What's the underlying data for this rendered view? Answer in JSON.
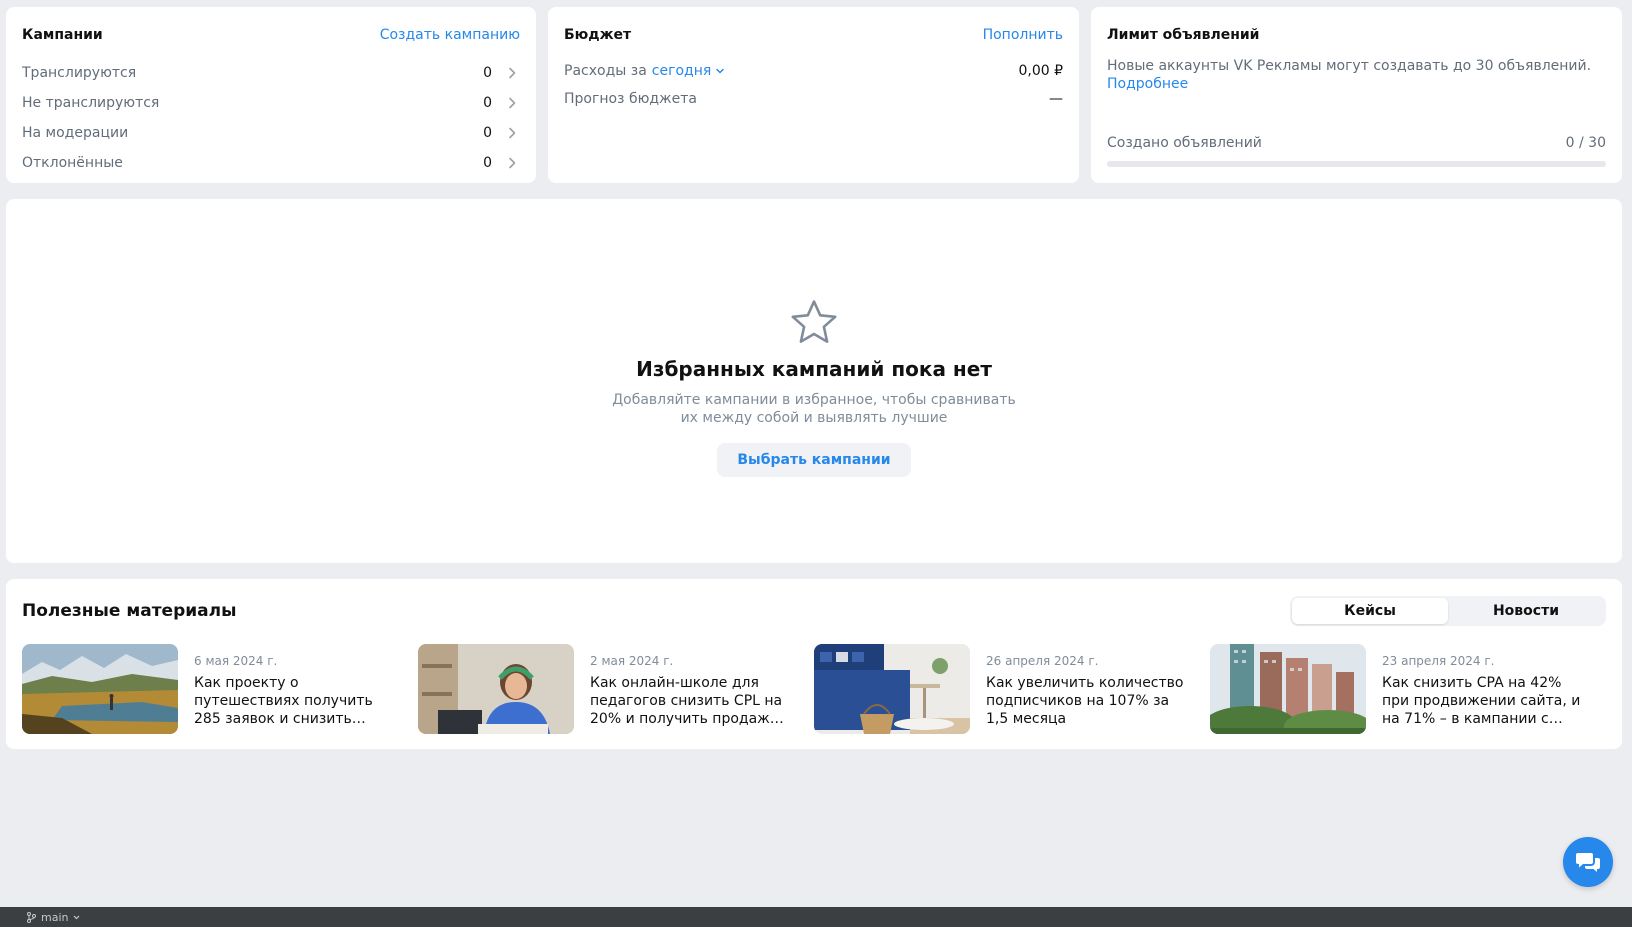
{
  "campaigns": {
    "title": "Кампании",
    "create_link": "Создать кампанию",
    "rows": [
      {
        "label": "Транслируются",
        "value": "0"
      },
      {
        "label": "Не транслируются",
        "value": "0"
      },
      {
        "label": "На модерации",
        "value": "0"
      },
      {
        "label": "Отклонённые",
        "value": "0"
      }
    ]
  },
  "budget": {
    "title": "Бюджет",
    "topup_link": "Пополнить",
    "expenses_label": "Расходы за",
    "period": "сегодня",
    "expenses_value": "0,00 ₽",
    "forecast_label": "Прогноз бюджета",
    "forecast_value": "—"
  },
  "limit": {
    "title": "Лимит объявлений",
    "text": "Новые аккаунты VK Рекламы могут создавать до 30 объявлений.",
    "more_link": "Подробнее",
    "created_label": "Создано объявлений",
    "created_value": "0 / 30",
    "progress_fraction": 0
  },
  "favorites": {
    "title": "Избранных кампаний пока нет",
    "description": "Добавляйте кампании в избранное, чтобы сравнивать их между собой и выявлять лучшие",
    "button": "Выбрать кампании",
    "icon": "star-outline-icon"
  },
  "materials": {
    "title": "Полезные материалы",
    "tabs": [
      {
        "label": "Кейсы",
        "active": true
      },
      {
        "label": "Новости",
        "active": false
      }
    ],
    "articles": [
      {
        "date": "6 мая 2024 г.",
        "title": "Как проекту о путешествиях получить 285 заявок и снизить…"
      },
      {
        "date": "2 мая 2024 г.",
        "title": "Как онлайн-школе для педагогов снизить CPL на 20% и получить продаж…"
      },
      {
        "date": "26 апреля 2024 г.",
        "title": "Как увеличить количество подписчиков на 107% за 1,5 месяца"
      },
      {
        "date": "23 апреля 2024 г.",
        "title": "Как снизить CPA на 42% при продвижении сайта, и на 71% – в кампании с…"
      }
    ]
  },
  "chat": {
    "icon": "chat-icon"
  },
  "status_bar": {
    "branch": "main"
  },
  "colors": {
    "accent": "#2688eb",
    "page_bg": "#ebedf0",
    "muted_text": "#626d7a"
  }
}
